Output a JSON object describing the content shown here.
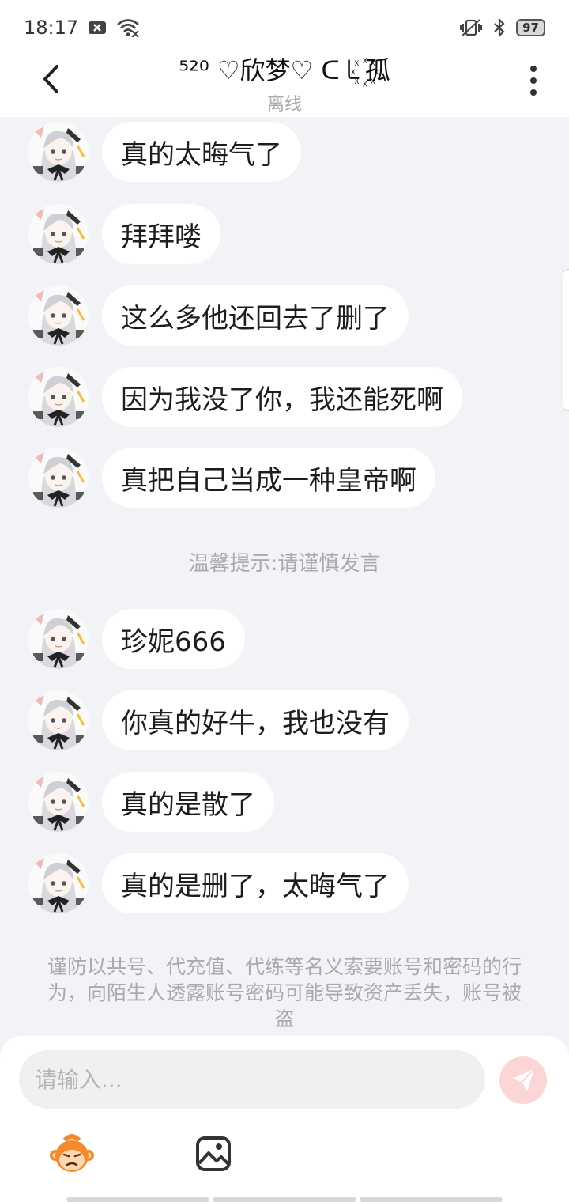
{
  "status_bar": {
    "time": "18:17",
    "battery": "97",
    "icons": [
      "notification-x-icon",
      "wifi-icon",
      "vibrate-icon",
      "bluetooth-icon",
      "battery-icon"
    ]
  },
  "header": {
    "back_icon": "chevron-left-icon",
    "title": "⁵²⁰ ♡欣梦♡  ᑕ㇄꙰孤",
    "subtitle": "离线",
    "more_icon": "more-vertical-icon"
  },
  "messages_group_1": [
    {
      "text": "真的太晦气了"
    },
    {
      "text": "拜拜喽"
    },
    {
      "text": "这么多他还回去了删了"
    },
    {
      "text": "因为我没了你，我还能死啊"
    },
    {
      "text": "真把自己当成一种皇帝啊"
    }
  ],
  "tip": "温馨提示:请谨慎发言",
  "messages_group_2": [
    {
      "text": "珍妮666"
    },
    {
      "text": "你真的好牛，我也没有"
    },
    {
      "text": "真的是散了"
    },
    {
      "text": "真的是删了，太晦气了"
    }
  ],
  "security_warning": "谨防以共号、代充值、代练等名义索要账号和密码的行为，向陌生人透露账号密码可能导致资产丢失，账号被盗",
  "composer": {
    "placeholder": "请输入...",
    "send_icon": "send-icon",
    "emoji_icon": "monkey-emoji-icon",
    "image_icon": "image-icon"
  },
  "colors": {
    "background": "#f2f3f7",
    "bubble": "#ffffff",
    "send_button": "#fcd6d6",
    "hint_text": "#aaaaaa"
  }
}
